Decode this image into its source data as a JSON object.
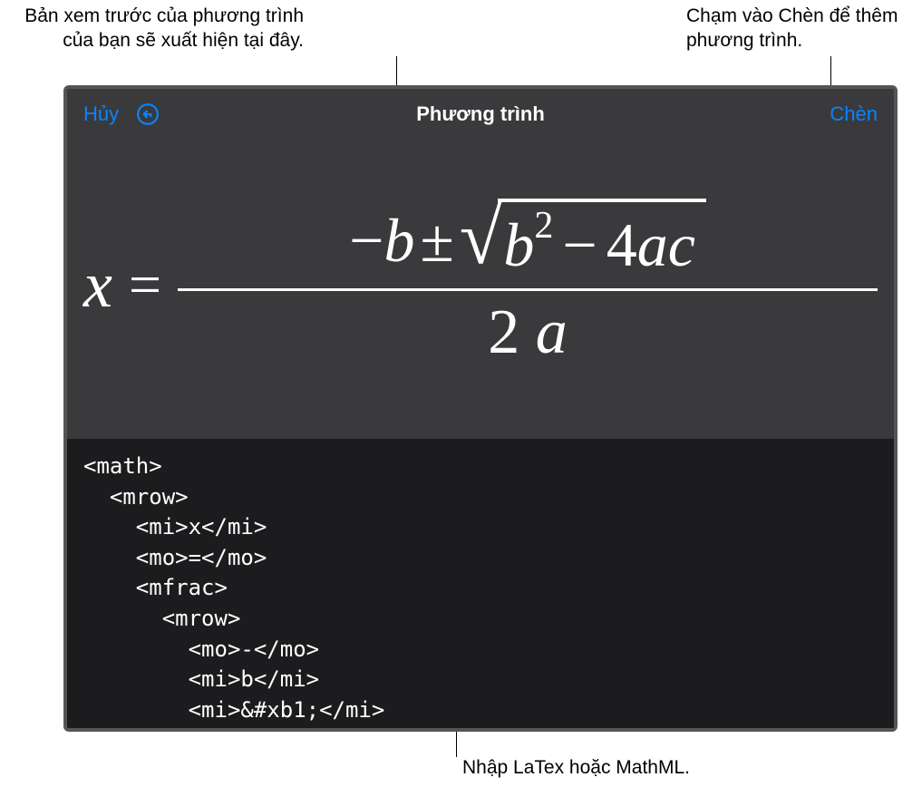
{
  "callouts": {
    "preview": "Bản xem trước của phương trình của bạn sẽ xuất hiện tại đây.",
    "insert_hint": "Chạm vào Chèn để thêm phương trình.",
    "input_hint": "Nhập LaTex hoặc MathML."
  },
  "toolbar": {
    "cancel_label": "Hủy",
    "title": "Phương trình",
    "insert_label": "Chèn"
  },
  "equation": {
    "variable": "x",
    "equals": "=",
    "numerator_minus": "−",
    "numerator_b": "b",
    "plus_minus": "±",
    "sqrt_sym": "√",
    "b_inside": "b",
    "exponent": "2",
    "minus_inside": "−",
    "four": "4",
    "a_inside": "a",
    "c_inside": "c",
    "denom_two": "2",
    "denom_a": "a"
  },
  "code": {
    "line1": "<math>",
    "line2": "  <mrow>",
    "line3": "    <mi>x</mi>",
    "line4": "    <mo>=</mo>",
    "line5": "    <mfrac>",
    "line6": "      <mrow>",
    "line7": "        <mo>-</mo>",
    "line8": "        <mi>b</mi>",
    "line9": "        <mi>&#xb1;</mi>"
  }
}
